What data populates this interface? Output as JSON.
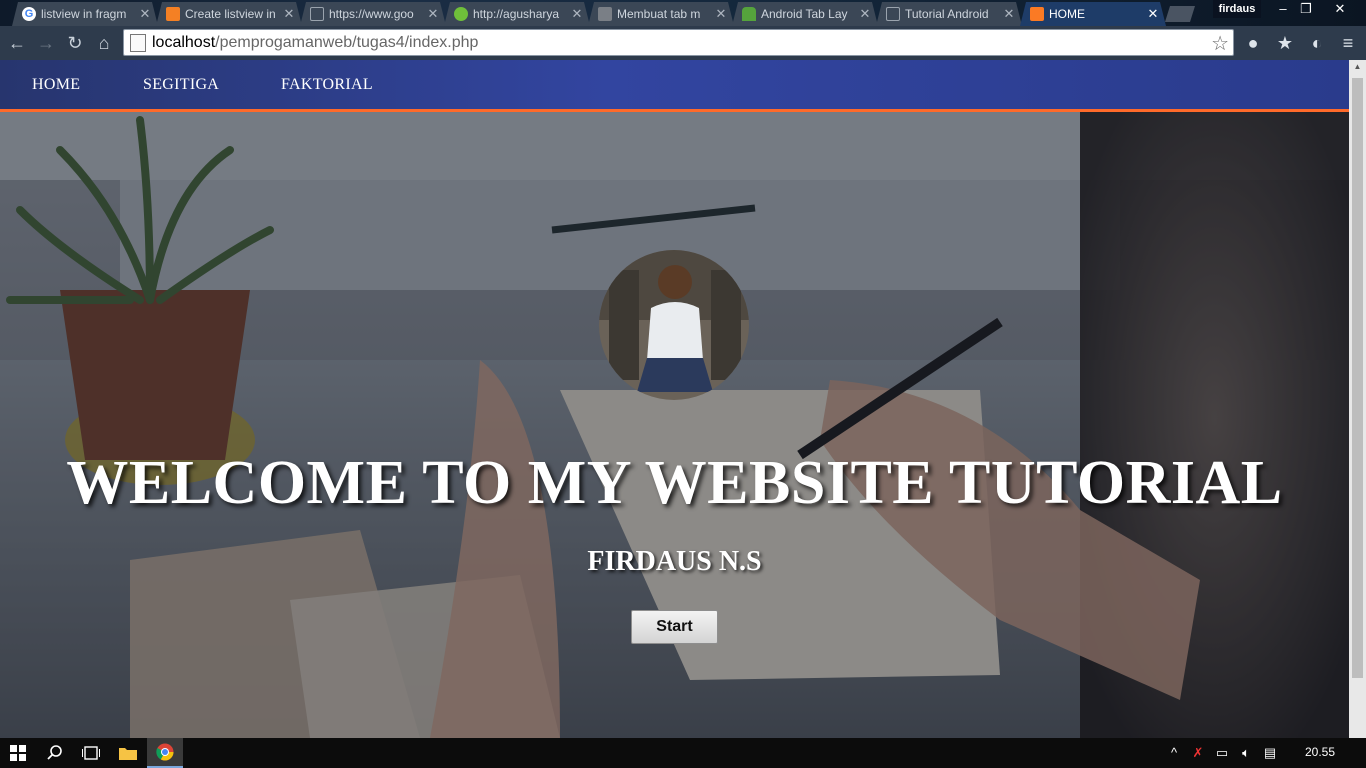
{
  "browser": {
    "tabs": [
      {
        "title": "listview in fragm",
        "icon": "google-g-icon",
        "active": false
      },
      {
        "title": "Create listview in",
        "icon": "stackoverflow-icon",
        "active": false
      },
      {
        "title": "https://www.goo",
        "icon": "page-icon",
        "active": false
      },
      {
        "title": "http://agusharya",
        "icon": "gear-icon",
        "active": false
      },
      {
        "title": "Membuat tab m",
        "icon": "site-icon",
        "active": false
      },
      {
        "title": "Android Tab Lay",
        "icon": "android-icon",
        "active": false
      },
      {
        "title": "Tutorial Android",
        "icon": "page-icon",
        "active": false
      },
      {
        "title": "HOME",
        "icon": "xampp-icon",
        "active": true
      }
    ],
    "profile_name": "firdaus",
    "url_host": "localhost",
    "url_path": "/pemprogamanweb/tugas4/index.php"
  },
  "site": {
    "nav": [
      "HOME",
      "SEGITIGA",
      "FAKTORIAL"
    ],
    "title": "WELCOME TO MY WEBSITE TUTORIAL",
    "subtitle": "FIRDAUS N.S",
    "start_label": "Start",
    "accent_color": "#ff6a2a",
    "nav_color": "#3245a0"
  },
  "taskbar": {
    "clock": "20.55"
  }
}
